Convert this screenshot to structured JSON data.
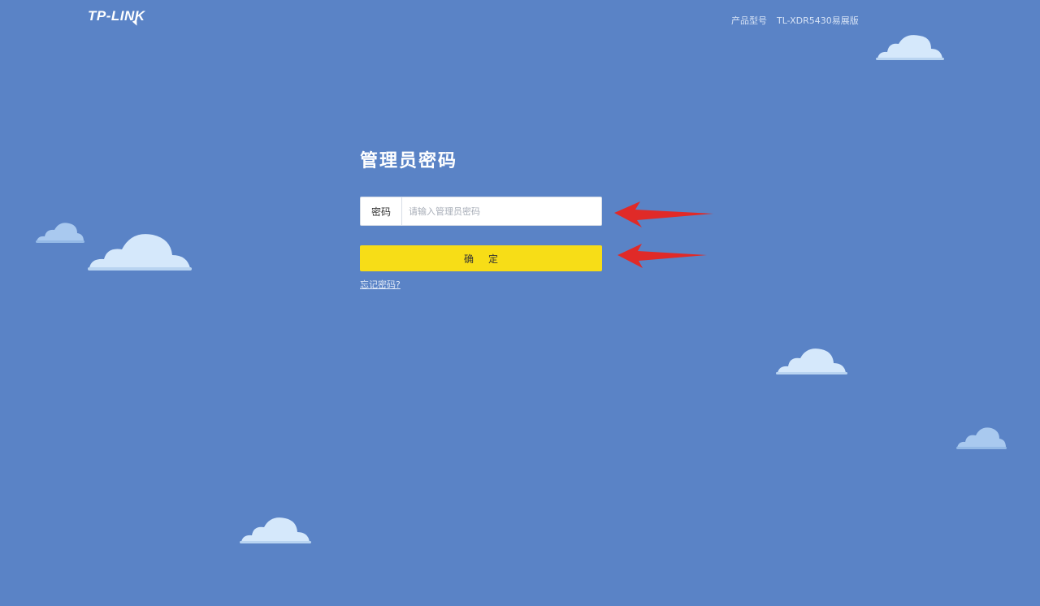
{
  "header": {
    "logo_text": "TP-LINK",
    "model_label": "产品型号",
    "model_value": "TL-XDR5430易展版"
  },
  "login": {
    "title": "管理员密码",
    "password_label": "密码",
    "password_placeholder": "请输入管理员密码",
    "password_value": "",
    "confirm_label": "确定",
    "forgot_link": "忘记密码?"
  },
  "colors": {
    "background": "#5a83c6",
    "button": "#f7dd17",
    "cloud": "#d5e8fb",
    "annotation_arrow": "#e02a28"
  },
  "annotations": {
    "arrows": [
      "annotation-arrow",
      "annotation-arrow"
    ]
  }
}
